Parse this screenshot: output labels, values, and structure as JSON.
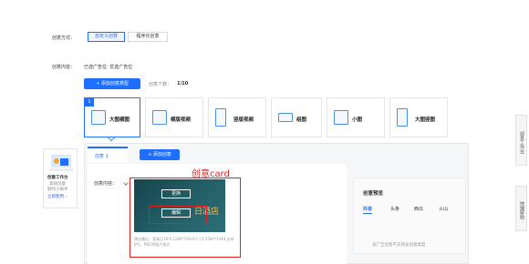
{
  "mode": {
    "label": "创意方式：",
    "options": [
      "自定义创意",
      "程序化创意"
    ],
    "active": 0
  },
  "content": {
    "label": "创意内容：",
    "value": "已选广告位:  优选广告位"
  },
  "add_type": {
    "button_label": "+ 添加创意类型",
    "count_label": "创意个数：",
    "count_value": "1/10"
  },
  "types": [
    {
      "label": "大图横图",
      "badge": "1"
    },
    {
      "label": "横版视频"
    },
    {
      "label": "竖版视频"
    },
    {
      "label": "组图"
    },
    {
      "label": "小图"
    },
    {
      "label": "大图竖图"
    }
  ],
  "assistant": {
    "title": "创意工作台",
    "desc1": "高效创意",
    "desc2": "制作小助手",
    "link": "立即使用 ›"
  },
  "creative": {
    "tab_label": "创意 1",
    "add_button": "+ 添加创意",
    "content_label": "创意内容：",
    "annotation": "创意card",
    "replace_label": "更换",
    "edit_label": "编辑",
    "image_text": "日酒店",
    "hint": "建议最佳：宽高比16:9,1280*720/4尺寸4,2560*1440,支持JPG、PNG等图片格式"
  },
  "preview": {
    "title": "创意预览",
    "tabs": [
      "抖音",
      "头条",
      "西瓜",
      "火山"
    ],
    "active": 0,
    "message": "该广告位暂不支持该创意类型"
  },
  "side": {
    "workbench": "创意工作台",
    "help": "快捷帮助"
  },
  "colors": {
    "primary": "#1e6fff",
    "annotation": "#e0201e"
  }
}
